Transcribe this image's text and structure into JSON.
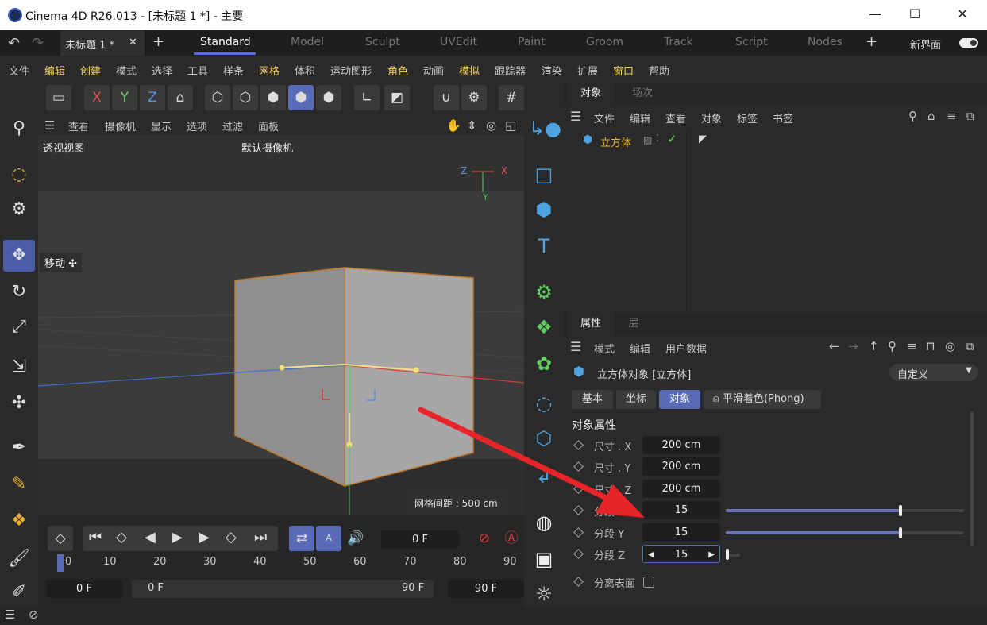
{
  "window": {
    "title": "Cinema 4D R26.013 - [未标题 1 *] - 主要",
    "min": "—",
    "max": "☐",
    "close": "✕"
  },
  "tabs": {
    "doc": "未标题 1 *",
    "doc_close": "✕",
    "add": "+",
    "layouts": [
      "Standard",
      "Model",
      "Sculpt",
      "UVEdit",
      "Paint",
      "Groom",
      "Track",
      "Script",
      "Nodes"
    ],
    "new_ui": "新界面"
  },
  "menu": [
    "文件",
    "编辑",
    "创建",
    "模式",
    "选择",
    "工具",
    "样条",
    "网格",
    "体积",
    "运动图形",
    "角色",
    "动画",
    "模拟",
    "跟踪器",
    "渲染",
    "扩展",
    "窗口",
    "帮助"
  ],
  "toolbar": {
    "x": "X",
    "y": "Y",
    "z": "Z"
  },
  "viewport": {
    "menu": [
      "查看",
      "摄像机",
      "显示",
      "选项",
      "过滤",
      "面板"
    ],
    "name": "透视视图",
    "camera": "默认摄像机",
    "move_label": "移动",
    "grid": "网格间距 : 500 cm",
    "axis_z": "Z",
    "axis_x": "X",
    "axis_y": "Y"
  },
  "timeline": {
    "frame": "0 F",
    "ruler": [
      "0",
      "10",
      "20",
      "30",
      "40",
      "50",
      "60",
      "70",
      "80",
      "90"
    ],
    "start": "0 F",
    "range_start": "0 F",
    "range_end": "90 F",
    "end": "90 F"
  },
  "objects": {
    "tabs": [
      "对象",
      "场次"
    ],
    "menu": [
      "文件",
      "编辑",
      "查看",
      "对象",
      "标签",
      "书签"
    ],
    "item": "立方体"
  },
  "attributes": {
    "tabs": [
      "属性",
      "层"
    ],
    "menu": [
      "模式",
      "编辑",
      "用户数据"
    ],
    "title": "立方体对象 [立方体]",
    "preset": "自定义",
    "subtabs": [
      "基本",
      "坐标",
      "对象",
      "平滑着色(Phong)"
    ],
    "section": "对象属性",
    "rows": [
      {
        "label": "尺寸 . X",
        "value": "200 cm"
      },
      {
        "label": "尺寸 . Y",
        "value": "200 cm"
      },
      {
        "label": "尺寸 . Z",
        "value": "200 cm"
      },
      {
        "label": "分段 X",
        "value": "15"
      },
      {
        "label": "分段 Y",
        "value": "15"
      },
      {
        "label": "分段 Z",
        "value": "15"
      }
    ],
    "separate": "分离表面"
  },
  "colors": {
    "accent": "#5a6bb6",
    "arrow": "#e8232a"
  }
}
